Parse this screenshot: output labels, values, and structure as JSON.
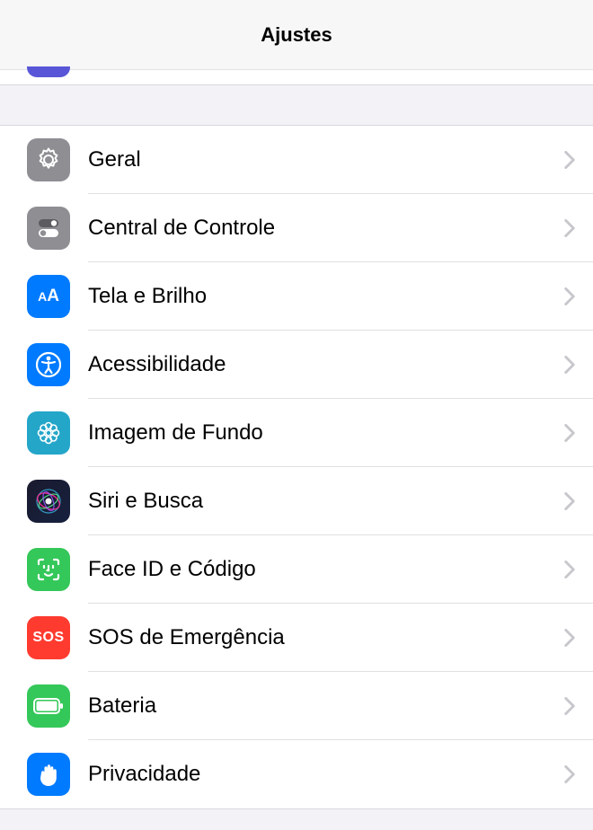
{
  "header": {
    "title": "Ajustes"
  },
  "rows": {
    "general": {
      "label": "Geral"
    },
    "control_center": {
      "label": "Central de Controle"
    },
    "display": {
      "label": "Tela e Brilho"
    },
    "accessibility": {
      "label": "Acessibilidade"
    },
    "wallpaper": {
      "label": "Imagem de Fundo"
    },
    "siri": {
      "label": "Siri e Busca"
    },
    "faceid": {
      "label": "Face ID e Código"
    },
    "sos": {
      "label": "SOS de Emergência",
      "icon_text": "SOS"
    },
    "battery": {
      "label": "Bateria"
    },
    "privacy": {
      "label": "Privacidade"
    }
  }
}
